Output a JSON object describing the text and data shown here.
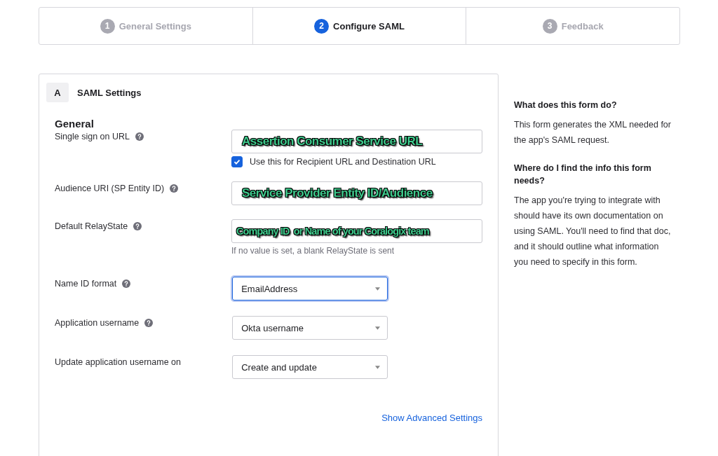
{
  "steps": [
    {
      "number": "1",
      "label": "General Settings",
      "selected": false
    },
    {
      "number": "2",
      "label": "Configure SAML",
      "selected": true
    },
    {
      "number": "3",
      "label": "Feedback",
      "selected": false
    }
  ],
  "section": {
    "letter": "A",
    "title": "SAML Settings"
  },
  "group_title": "General",
  "fields": [
    {
      "kind": "text",
      "label": "Single sign on URL",
      "help": true,
      "annotation": "Assertion Consumer Service URL",
      "checkbox": {
        "label": "Use this for Recipient URL and Destination URL",
        "checked": true
      }
    },
    {
      "kind": "text",
      "label": "Audience URI (SP Entity ID)",
      "help": true,
      "annotation": "Service Provider Entity ID/Audience"
    },
    {
      "kind": "text",
      "label": "Default RelayState",
      "help": true,
      "annotation": "Company ID  or Name of your Coralogix team",
      "hint": "If no value is set, a blank RelayState is sent"
    },
    {
      "kind": "select",
      "label": "Name ID format",
      "help": true,
      "value": "EmailAddress",
      "focused": true
    },
    {
      "kind": "select",
      "label": "Application username",
      "help": true,
      "value": "Okta username",
      "focused": false
    },
    {
      "kind": "select",
      "label": "Update application username on",
      "help": false,
      "value": "Create and update",
      "focused": false
    }
  ],
  "link": "Show Advanced Settings",
  "sidebar": [
    {
      "heading": "What does this form do?",
      "text": "This form generates the XML needed for the app's SAML request."
    },
    {
      "heading": "Where do I find the info this form needs?",
      "text": "The app you're trying to integrate with should have its own documentation on using SAML. You'll need to find that doc, and it should outline what information you need to specify in this form."
    }
  ]
}
